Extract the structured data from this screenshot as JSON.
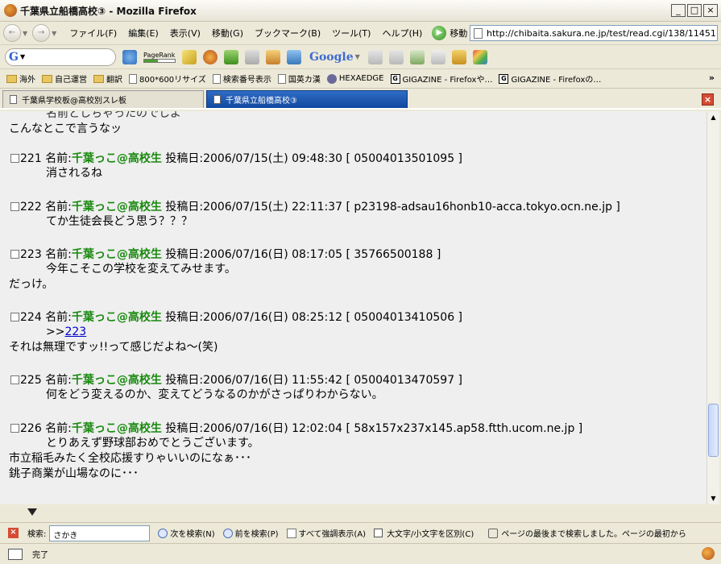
{
  "window": {
    "title": "千葉県立船橋高校③ - Mozilla Firefox",
    "btn_min": "_",
    "btn_max": "□",
    "btn_close": "×"
  },
  "menu": {
    "back": "←",
    "forward": "→",
    "items": [
      "ファイル(F)",
      "編集(E)",
      "表示(V)",
      "移動(G)",
      "ブックマーク(B)",
      "ツール(T)",
      "ヘルプ(H)"
    ],
    "go_label": "移動",
    "url": "http://chibaita.sakura.ne.jp/test/read.cgi/138/11451"
  },
  "toolbar": {
    "google_search_label": "G",
    "pagerank": "PageRank",
    "google_button": "Google"
  },
  "bookmarks": [
    "海外",
    "自己運営",
    "翻訳",
    "800*600リサイズ",
    "検索番号表示",
    "国英カ漢",
    "HEXAEDGE",
    "GIGAZINE - Firefoxや…",
    "GIGAZINE - Firefoxの…"
  ],
  "bookmarks_more": "»",
  "tabs": [
    {
      "label": "千葉県学校板@高校別スレ板"
    },
    {
      "label": "千葉県立船橋高校③"
    }
  ],
  "tab_close": "×",
  "thread": {
    "top_lines": [
      "名前としちゃったのでしよ",
      "こんなとこで言うなッ"
    ],
    "name_label": "名前:",
    "date_label": "投稿日:",
    "posts": [
      {
        "num": "221",
        "name": "千葉っこ@高校生",
        "date": "2006/07/15(土) 09:48:30",
        "id": "[ 05004013501095 ]",
        "lines": [
          "消されるね"
        ],
        "extra": []
      },
      {
        "num": "222",
        "name": "千葉っこ@高校生",
        "date": "2006/07/15(土) 22:11:37",
        "id": "[ p23198-adsau16honb10-acca.tokyo.ocn.ne.jp ]",
        "lines": [
          "てか生徒会長どう思う？？？"
        ],
        "extra": []
      },
      {
        "num": "223",
        "name": "千葉っこ@高校生",
        "date": "2006/07/16(日) 08:17:05",
        "id": "[ 35766500188 ]",
        "lines": [
          "今年こそこの学校を変えてみせます。"
        ],
        "extra": [
          "だっけ。"
        ]
      },
      {
        "num": "224",
        "name": "千葉っこ@高校生",
        "date": "2006/07/16(日) 08:25:12",
        "id": "[ 05004013410506 ]",
        "link_prefix": ">>",
        "link": "223",
        "lines": [],
        "extra": [
          "それは無理ですッ!!って感じだよね～(笑)"
        ]
      },
      {
        "num": "225",
        "name": "千葉っこ@高校生",
        "date": "2006/07/16(日) 11:55:42",
        "id": "[ 05004013470597 ]",
        "lines": [
          "何をどう変えるのか、変えてどうなるのかがさっぱりわからない。"
        ],
        "extra": []
      },
      {
        "num": "226",
        "name": "千葉っこ@高校生",
        "date": "2006/07/16(日) 12:02:04",
        "id": "[ 58x157x237x145.ap58.ftth.ucom.ne.jp ]",
        "lines": [
          "とりあえず野球部おめでとうございます。"
        ],
        "extra": [
          "市立稲毛みたく全校応援すりゃいいのになぁ･･･",
          "銚子商業が山場なのに･･･"
        ]
      }
    ]
  },
  "findbar": {
    "close": "×",
    "label": "検索:",
    "value": "さかき",
    "next": "次を検索(N)",
    "prev": "前を検索(P)",
    "highlight": "すべて強調表示(A)",
    "match_case": "大文字/小文字を区別(C)",
    "message": "ページの最後まで検索しました。ページの最初から"
  },
  "status": {
    "text": "完了"
  }
}
